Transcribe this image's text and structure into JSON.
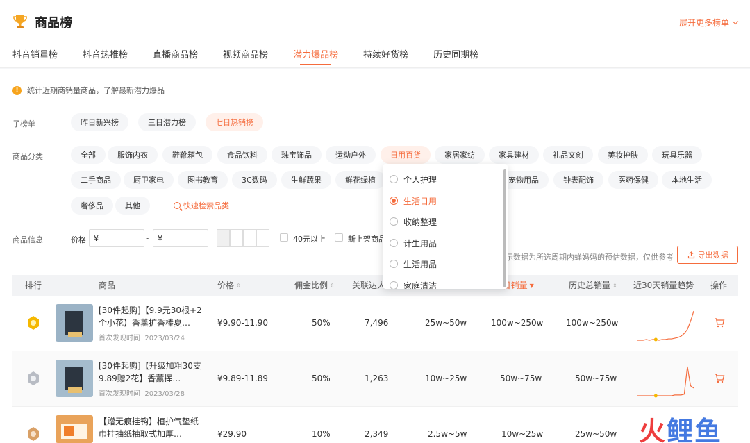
{
  "header": {
    "title": "商品榜",
    "more": "展开更多榜单"
  },
  "tabs": [
    {
      "label": "抖音销量榜"
    },
    {
      "label": "抖音热推榜"
    },
    {
      "label": "直播商品榜"
    },
    {
      "label": "视频商品榜"
    },
    {
      "label": "潜力爆品榜",
      "active": true
    },
    {
      "label": "持续好货榜"
    },
    {
      "label": "历史同期榜"
    }
  ],
  "notice": "统计近期商销量商品，了解最新潜力爆品",
  "sub_list": {
    "label": "子榜单",
    "items": [
      "昨日新兴榜",
      "三日潜力榜",
      "七日热销榜"
    ],
    "active_index": 2
  },
  "category": {
    "label": "商品分类",
    "row1": [
      "全部",
      "服饰内衣",
      "鞋靴箱包",
      "食品饮料",
      "珠宝饰品",
      "运动户外",
      "日用百货",
      "家居家纺",
      "家具建材",
      "礼品文创",
      "美妆护肤",
      "玩具乐器"
    ],
    "row2": [
      "二手商品",
      "厨卫家电",
      "图书教育",
      "3C数码",
      "生鲜蔬果",
      "鲜花绿植",
      "宠物用品",
      "钟表配饰",
      "医药保健",
      "本地生活"
    ],
    "row3": [
      "奢侈品",
      "其他"
    ],
    "quick_search": "快速检索品类",
    "active": "日用百货"
  },
  "product_info": {
    "label": "商品信息",
    "price_label": "价格",
    "price_min": "¥",
    "price_max": "¥",
    "dash": "-",
    "checkbox1": "40元以上",
    "checkbox2": "新上架商品"
  },
  "export": {
    "note": "示数据为所选周期内蝉妈妈的预估数据，仅供参考",
    "button": "导出数据"
  },
  "dropdown": {
    "items": [
      "个人护理",
      "生活日用",
      "收纳整理",
      "计生用品",
      "生活用品",
      "家庭清洁"
    ],
    "selected_index": 1
  },
  "table": {
    "headers": {
      "rank": "排行",
      "product": "商品",
      "price": "价格",
      "commission": "佣金比例",
      "influencers": "关联达人",
      "sales7": "7日销量",
      "history": "历史总销量",
      "trend": "近30天销量趋势",
      "action": "操作"
    },
    "rows": [
      {
        "name": "[30件起购]【9.9元30根+2个小花】香薰扩香棒夏…",
        "first_seen_label": "首次发现时间",
        "first_seen": "2023/03/24",
        "price": "¥9.90-11.90",
        "commission": "50%",
        "influencers": "7,496",
        "sales_a": "25w~50w",
        "sales7": "100w~250w",
        "history": "100w~250w",
        "medal_color": "#f5b800",
        "trend": [
          2,
          2,
          2,
          3,
          2,
          3,
          3,
          2,
          3,
          3,
          4,
          4,
          5,
          6,
          8,
          12,
          18,
          30,
          45
        ]
      },
      {
        "name": "[30件起购]【升级加粗30支9.89赠2花】香薰挥…",
        "first_seen_label": "首次发现时间",
        "first_seen": "2023/03/28",
        "price": "¥9.89-11.89",
        "commission": "50%",
        "influencers": "1,263",
        "sales_a": "10w~25w",
        "sales7": "50w~75w",
        "history": "50w~75w",
        "medal_color": "#b8bcc4",
        "trend": [
          2,
          2,
          2,
          2,
          2,
          2,
          2,
          2,
          2,
          2,
          2,
          2,
          3,
          3,
          3,
          4,
          40,
          15,
          12
        ]
      },
      {
        "name": "【赠无痕挂钩】植护气垫纸巾挂抽纸抽取式加厚…",
        "first_seen_label": "",
        "first_seen": "",
        "price": "¥29.90",
        "commission": "10%",
        "influencers": "2,349",
        "sales_a": "2.5w~5w",
        "sales7": "10w~25w",
        "history": "25w~50w",
        "medal_color": "#d9a066",
        "trend": []
      }
    ]
  },
  "watermark": {
    "a": "火",
    "b": "鲤",
    "c": "鱼"
  },
  "colors": {
    "accent": "#f56c3d",
    "bg": "#f5f6f8"
  }
}
